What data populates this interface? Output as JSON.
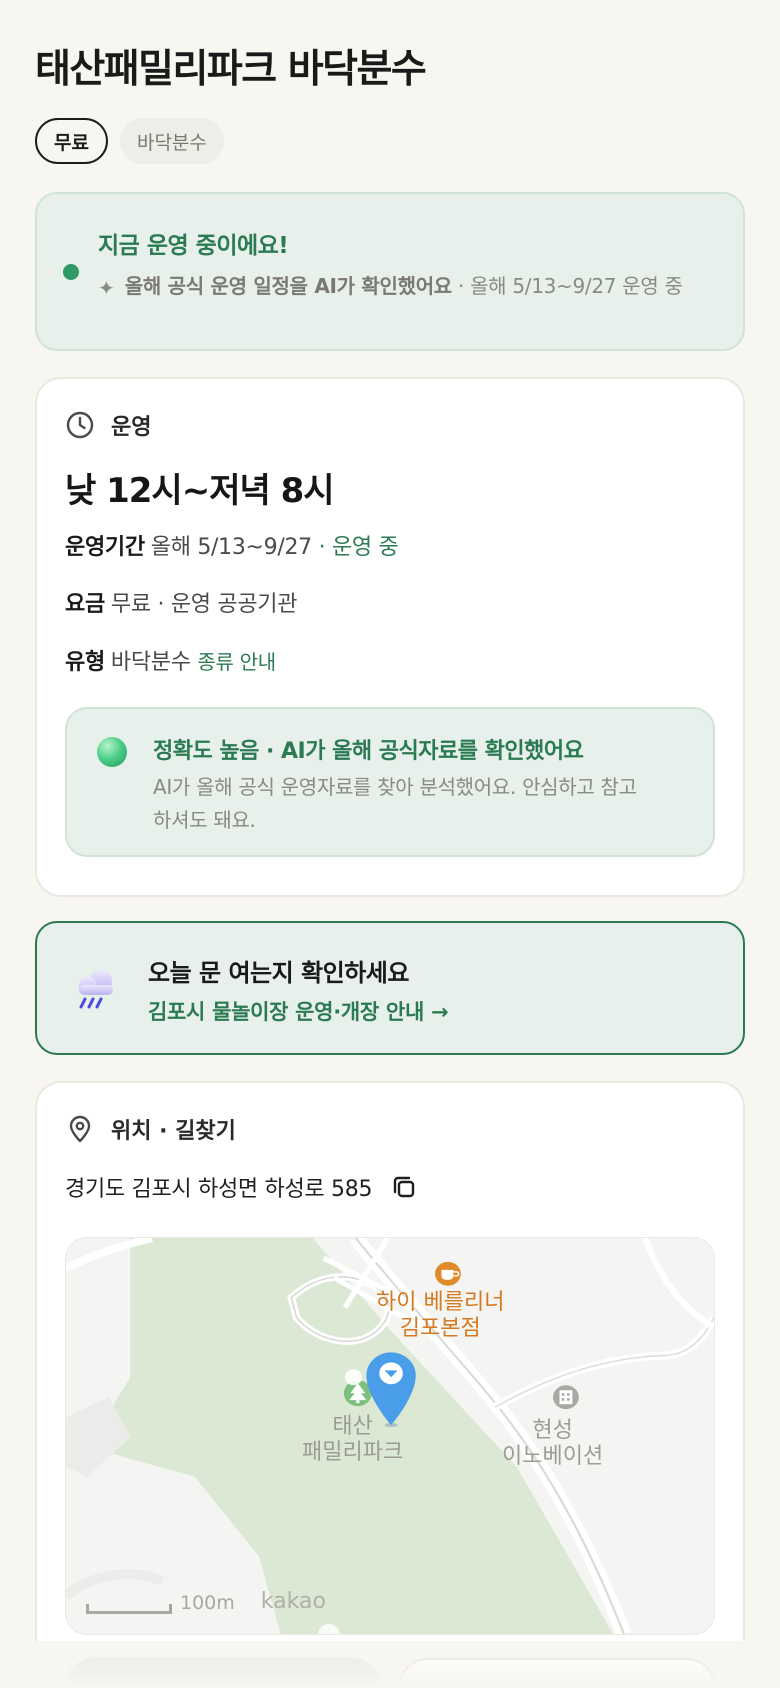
{
  "header": {
    "title": "태산패밀리파크 바닥분수"
  },
  "chips": [
    {
      "label": "무료"
    },
    {
      "label": "바닥분수"
    }
  ],
  "status": {
    "title": "지금 운영 중이에요!",
    "ai_note_bold": "올해 공식 운영 일정을 AI가 확인했어요",
    "ai_note_rest": " · 올해 5/13~9/27 운영 중"
  },
  "operation": {
    "section_title": "운영",
    "hours": "낮 12시~저녁 8시",
    "period_label": "운영기간",
    "period_value": "올해 5/13~9/27",
    "period_sep": " · ",
    "period_status": "운영 중",
    "fee_label": "요금",
    "fee_value": "무료 · 운영 공공기관",
    "type_label": "유형",
    "type_value": "바닥분수",
    "type_link": "종류 안내",
    "accuracy_title": "정확도 높음 · AI가 올해 공식자료를 확인했어요",
    "accuracy_text": "AI가 올해 공식 운영자료를 찾아 분석했어요. 안심하고 참고하셔도 돼요."
  },
  "cta": {
    "title": "오늘 문 여는지 확인하세요",
    "link": "김포시 물놀이장 운영·개장 안내 →"
  },
  "location": {
    "section_title": "위치 · 길찾기",
    "address": "경기도 김포시 하성면 하성로 585",
    "map": {
      "poi_cafe": "하이 베를리너\n김포본점",
      "poi_park": "태산\n패밀리파크",
      "poi_corp": "현성\n이노베이션",
      "scale": "100m",
      "brand": "kakao"
    }
  },
  "colors": {
    "accent_green": "#2b7a52",
    "status_bg": "#e7f0ea",
    "pin_blue": "#4a9de8",
    "cafe_orange": "#d47a1f"
  }
}
